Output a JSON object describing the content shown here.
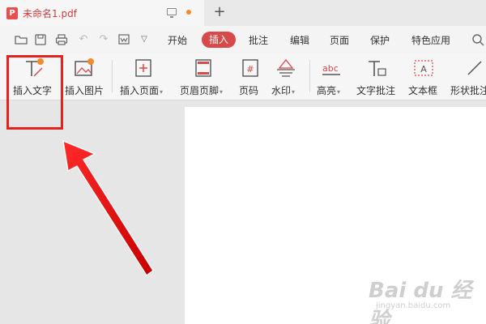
{
  "tab": {
    "pdf_glyph": "P",
    "title": "未命名1.pdf",
    "new_tab": "+"
  },
  "menu": {
    "items": [
      "开始",
      "插入",
      "批注",
      "编辑",
      "页面",
      "保护",
      "特色应用"
    ],
    "active": "插入"
  },
  "quick_access": {
    "open": "open-folder-icon",
    "save": "save-icon",
    "print": "print-icon",
    "undo": "undo-icon",
    "redo": "redo-icon",
    "export": "export-icon",
    "more": "chevron-down-icon",
    "search": "search-icon"
  },
  "ribbon": {
    "insert_text": "插入文字",
    "insert_image": "插入图片",
    "insert_page": "插入页面",
    "header_footer": "页眉页脚",
    "page_number": "页码",
    "watermark": "水印",
    "highlight": "高亮",
    "text_comment": "文字批注",
    "textbox": "文本框",
    "shape_comment": "形状批注"
  },
  "watermark": {
    "main": "Bai du 经验",
    "sub": "jingyan.baidu.com"
  },
  "colors": {
    "accent": "#d84949",
    "annotation": "#e52222",
    "badge": "#f08a2c"
  }
}
